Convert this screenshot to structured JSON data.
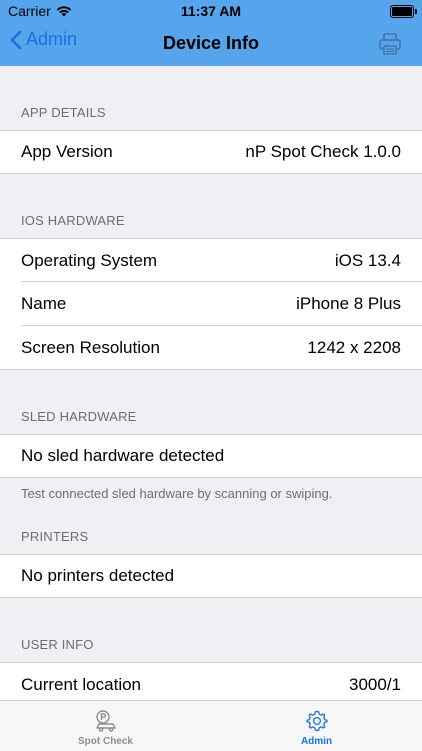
{
  "status": {
    "carrier": "Carrier",
    "time": "11:37 AM"
  },
  "nav": {
    "back_label": "Admin",
    "title": "Device Info"
  },
  "sections": {
    "app_details": {
      "header": "APP DETAILS",
      "rows": [
        {
          "label": "App Version",
          "value": "nP Spot Check 1.0.0"
        }
      ]
    },
    "ios_hardware": {
      "header": "IOS HARDWARE",
      "rows": [
        {
          "label": "Operating System",
          "value": "iOS 13.4"
        },
        {
          "label": "Name",
          "value": "iPhone 8 Plus"
        },
        {
          "label": "Screen Resolution",
          "value": "1242 x 2208"
        }
      ]
    },
    "sled_hardware": {
      "header": "SLED HARDWARE",
      "row": "No sled hardware detected",
      "footer": "Test connected sled hardware by scanning or swiping."
    },
    "printers": {
      "header": "PRINTERS",
      "row": "No printers detected"
    },
    "user_info": {
      "header": "USER INFO",
      "rows": [
        {
          "label": "Current location",
          "value": "3000/1"
        }
      ]
    }
  },
  "tabs": [
    {
      "label": "Spot Check",
      "icon": "spot-check-icon",
      "active": false
    },
    {
      "label": "Admin",
      "icon": "gear-icon",
      "active": true
    }
  ],
  "colors": {
    "nav_bar": "#56a5ec",
    "accent": "#1a70e3",
    "background": "#efeff4"
  }
}
